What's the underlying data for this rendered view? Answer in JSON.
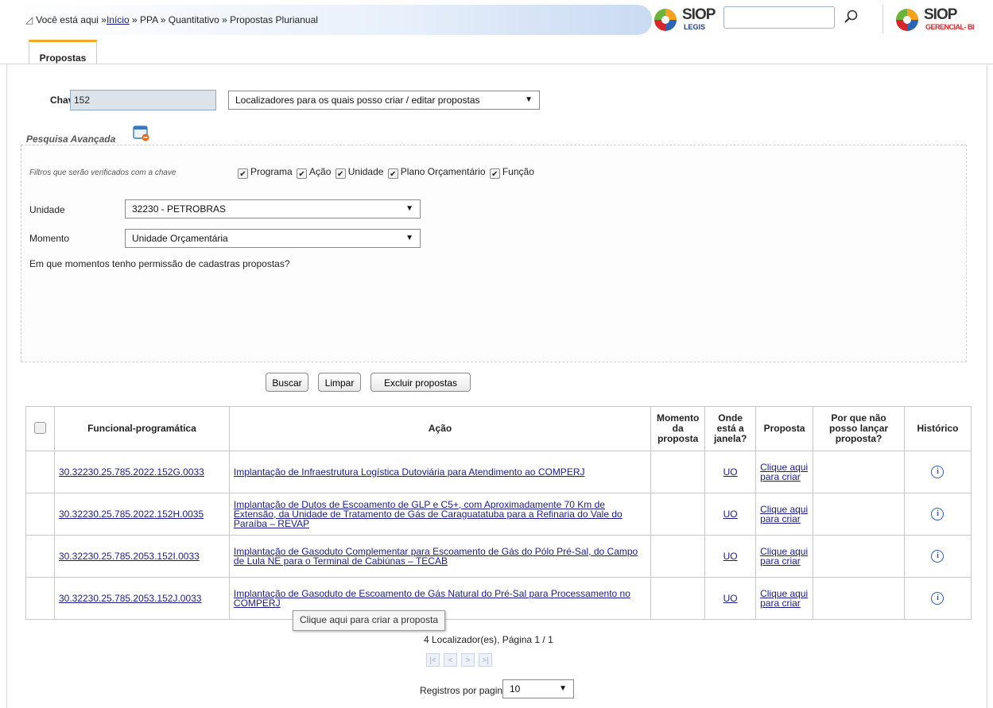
{
  "breadcrumb": {
    "prefix": "Você está aqui »",
    "home": "Início",
    "rest": " » PPA » Quantitativo » Propostas Plurianual"
  },
  "logos": {
    "legis_name": "SIOP",
    "legis_sub": "LEGIS",
    "gerencial_name": "SIOP",
    "gerencial_sub": "GERENCIAL- BI"
  },
  "search": {
    "value": "",
    "icon": "search-icon"
  },
  "tabs": [
    {
      "label": "Propostas",
      "active": true
    }
  ],
  "form": {
    "chave_label": "Chave",
    "chave_value": "152",
    "localizadores_select": "Localizadores para os quais posso criar / editar propostas",
    "advanced_title": "Pesquisa Avançada",
    "filters_label": "Filtros que serão verificados com a chave",
    "filters": [
      {
        "label": "Programa",
        "checked": true
      },
      {
        "label": "Ação",
        "checked": true
      },
      {
        "label": "Unidade",
        "checked": true
      },
      {
        "label": "Plano Orçamentário",
        "checked": true
      },
      {
        "label": "Função",
        "checked": true
      }
    ],
    "unidade_label": "Unidade",
    "unidade_value": "32230 - PETROBRAS",
    "momento_label": "Momento",
    "momento_value": "Unidade Orçamentária",
    "permission_text": "Em que momentos tenho permissão de cadastras propostas?"
  },
  "buttons": {
    "buscar": "Buscar",
    "limpar": "Limpar",
    "excluir": "Excluir propostas"
  },
  "table": {
    "headers": {
      "funcional": "Funcional-programática",
      "acao": "Ação",
      "momento": "Momento da proposta",
      "onde": "Onde está a janela?",
      "proposta": "Proposta",
      "porque": "Por que não posso lançar proposta?",
      "historico": "Histórico"
    },
    "rows": [
      {
        "funcional": "30.32230.25.785.2022.152G.0033",
        "acao": "Implantação de Infraestrutura Logística Dutoviária para Atendimento ao COMPERJ",
        "momento": "",
        "onde": "UO",
        "proposta": "Clique aqui para criar",
        "porque": ""
      },
      {
        "funcional": "30.32230.25.785.2022.152H.0035",
        "acao": "Implantação de Dutos de Escoamento de GLP e C5+, com Aproximadamente 70 Km de Extensão, da Unidade de Tratamento de Gás de Caraguatatuba para a Refinaria do Vale do Paraíba – REVAP",
        "momento": "",
        "onde": "UO",
        "proposta": "Clique aqui para criar",
        "porque": ""
      },
      {
        "funcional": "30.32230.25.785.2053.152I.0033",
        "acao": "Implantação de Gasoduto Complementar para Escoamento de Gás do Pólo Pré-Sal, do Campo de Lula NE para o Terminal de Cabiúnas – TECAB",
        "momento": "",
        "onde": "UO",
        "proposta": "Clique aqui para criar",
        "porque": ""
      },
      {
        "funcional": "30.32230.25.785.2053.152J.0033",
        "acao": "Implantação de Gasoduto de Escoamento de Gás Natural do Pré-Sal para Processamento no COMPERJ",
        "momento": "",
        "onde": "UO",
        "proposta": "Clique aqui para criar",
        "porque": ""
      }
    ]
  },
  "tooltip": "Clique aqui para criar a proposta",
  "pagination": {
    "info": "4 Localizador(es), Página 1 / 1",
    "per_page_label": "Registros por pagina",
    "per_page_value": "10"
  }
}
